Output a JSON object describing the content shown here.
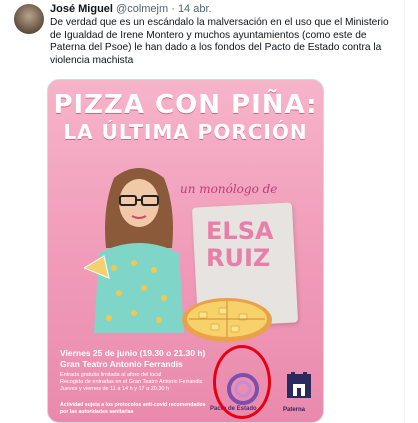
{
  "tweet": {
    "author_name": "José Miguel",
    "handle": "@colmejm",
    "separator": " · ",
    "date": "14 abr.",
    "text_lines": [
      "De verdad que es un escándalo la malversación en el uso que el Ministerio",
      "de Igualdad de Irene Montero y muchos ayuntamientos (como este de",
      "Paterna del Psoe) le han dado a los fondos del Pacto de Estado contra la",
      "violencia machista"
    ]
  },
  "poster": {
    "title_line1": "PIZZA CON PIÑA:",
    "title_line2": "LA ÚLTIMA PORCIÓN",
    "subtitle": "un monólogo de",
    "performer_first": "ELSA",
    "performer_last": "RUIZ",
    "date_time": "Viernes 25 de junio (19.30 o 21.30 h)",
    "venue": "Gran Teatro Antonio Ferrandis",
    "info_lines": [
      "Entrada gratuita limitada al aforo del local",
      "Recogida de entradas en el Gran Teatro Antonio Ferrandis",
      "Jueves y viernes de 11 a 14 h y 17 a 20.30 h"
    ],
    "safety_lines": [
      "Actividad sujeta a los protocolos anti-covid recomendados",
      "por las autoridades sanitarias"
    ],
    "logo_pacto": "Pacto de Estado",
    "logo_paterna": "Paterna"
  },
  "colors": {
    "poster_bg": "#f09ab8",
    "highlight_circle": "#e60012",
    "accent_text": "#e77fa9"
  }
}
